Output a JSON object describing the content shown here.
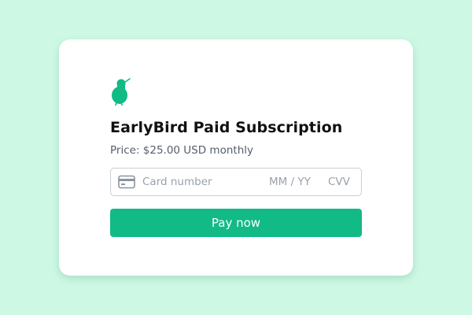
{
  "colors": {
    "page_background": "#cdf8e4",
    "card_background": "#ffffff",
    "accent": "#12ba85",
    "logo": "#12ba85"
  },
  "product": {
    "logo_icon": "kiwi-bird-icon",
    "title": "EarlyBird Paid Subscription",
    "price": "Price: $25.00 USD monthly"
  },
  "payment": {
    "card_icon": "credit-card-icon",
    "card_number_placeholder": "Card number",
    "expiry_placeholder": "MM / YY",
    "cvv_placeholder": "CVV"
  },
  "actions": {
    "pay_label": "Pay now"
  }
}
